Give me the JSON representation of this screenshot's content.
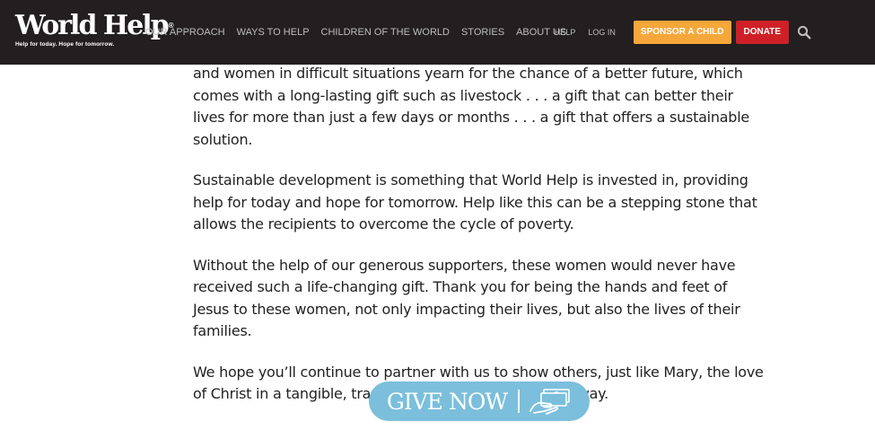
{
  "header": {
    "logo": {
      "name": "World Help",
      "reg": "®",
      "tagline": "Help for today. Hope for tomorrow."
    },
    "nav": [
      "OUR APPROACH",
      "WAYS TO HELP",
      "CHILDREN OF THE WORLD",
      "STORIES",
      "ABOUT US"
    ],
    "util": {
      "help": "HELP",
      "login": "LOG IN",
      "sponsor": "SPONSOR A CHILD",
      "donate": "DONATE"
    },
    "search_icon": "search-icon"
  },
  "article": {
    "paragraphs": [
      "and women in difficult situations yearn for the chance of a better future, which comes with a long-lasting gift such as livestock . . . a gift that can better their lives for more than just a few days or months . . . a gift that offers a sustainable solution.",
      "Sustainable development is something that World Help is invested in, providing help for today and hope for tomorrow. Help like this can be a stepping stone that allows the recipients to overcome the cycle of poverty.",
      "Without the help of our generous supporters, these women would never have received such a life-changing gift. Thank you for being the hands and feet of Jesus to these women, not only impacting their lives, but also the lives of their families.",
      "We hope you’ll continue to partner with us to show others, just like Mary, the love of Christ in a tangible, transformative, and sustainable way."
    ]
  },
  "cta": {
    "label": "GIVE NOW",
    "icon": "money-hand-icon"
  },
  "colors": {
    "header_bg": "#231f20",
    "sponsor": "#f6a73a",
    "donate": "#cf2027",
    "give": "#7bbfdc"
  }
}
